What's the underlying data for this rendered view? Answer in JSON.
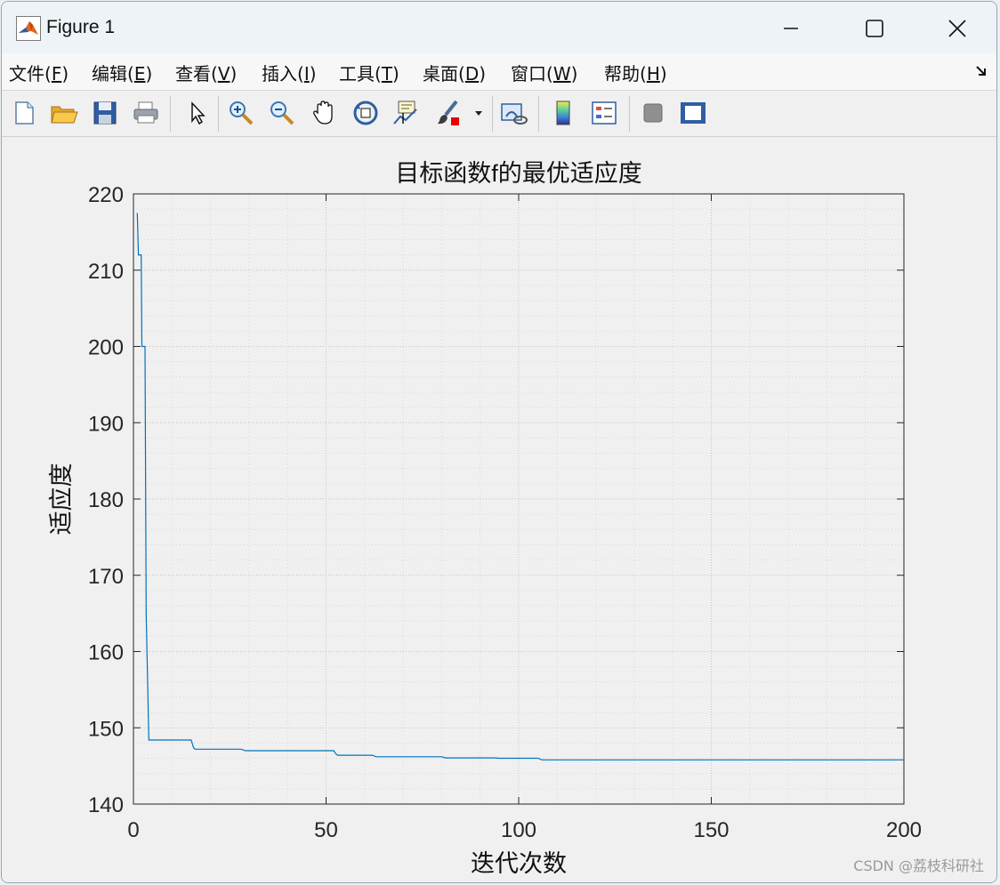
{
  "window": {
    "title": "Figure 1",
    "controls": {
      "minimize": "minimize",
      "maximize": "maximize",
      "close": "close"
    }
  },
  "menu": {
    "items": [
      {
        "label": "文件(",
        "key": "F",
        "tail": ")"
      },
      {
        "label": "编辑(",
        "key": "E",
        "tail": ")"
      },
      {
        "label": "查看(",
        "key": "V",
        "tail": ")"
      },
      {
        "label": "插入(",
        "key": "I",
        "tail": ")"
      },
      {
        "label": "工具(",
        "key": "T",
        "tail": ")"
      },
      {
        "label": "桌面(",
        "key": "D",
        "tail": ")"
      },
      {
        "label": "窗口(",
        "key": "W",
        "tail": ")"
      },
      {
        "label": "帮助(",
        "key": "H",
        "tail": ")"
      }
    ]
  },
  "toolbar": {
    "icons": [
      "new-figure-icon",
      "open-file-icon",
      "save-icon",
      "print-icon",
      "pointer-icon",
      "zoom-in-icon",
      "zoom-out-icon",
      "pan-hand-icon",
      "rotate-3d-icon",
      "data-cursor-icon",
      "brush-icon",
      "link-plot-icon",
      "colorbar-icon",
      "legend-icon",
      "hide-plot-tools-icon",
      "show-plot-tools-icon"
    ]
  },
  "colors": {
    "line": "#0072BD",
    "grid_minor": "#d9d9d9",
    "grid_major": "#c4c4c4"
  },
  "chart_data": {
    "type": "line",
    "title": "目标函数f的最优适应度",
    "xlabel": "迭代次数",
    "ylabel": "适应度",
    "xlim": [
      0,
      200
    ],
    "ylim": [
      140,
      220
    ],
    "xticks": [
      0,
      50,
      100,
      150,
      200
    ],
    "yticks": [
      140,
      150,
      160,
      170,
      180,
      190,
      200,
      210,
      220
    ],
    "grid": "major and minor (dotted)",
    "series": [
      {
        "x": [
          1,
          1.3,
          2,
          2.2,
          3,
          3.3,
          4,
          15,
          15.6,
          16,
          28,
          29,
          52,
          52.5,
          53,
          62,
          63,
          80,
          81,
          94,
          95,
          105,
          106,
          200
        ],
        "y": [
          217.5,
          212,
          212,
          200,
          200,
          165,
          148.4,
          148.4,
          147.4,
          147.2,
          147.2,
          147.0,
          147.0,
          146.6,
          146.4,
          146.4,
          146.2,
          146.2,
          146.05,
          146.05,
          146.0,
          146.0,
          145.8,
          145.8
        ]
      }
    ]
  },
  "watermark": "CSDN @荔枝科研社"
}
